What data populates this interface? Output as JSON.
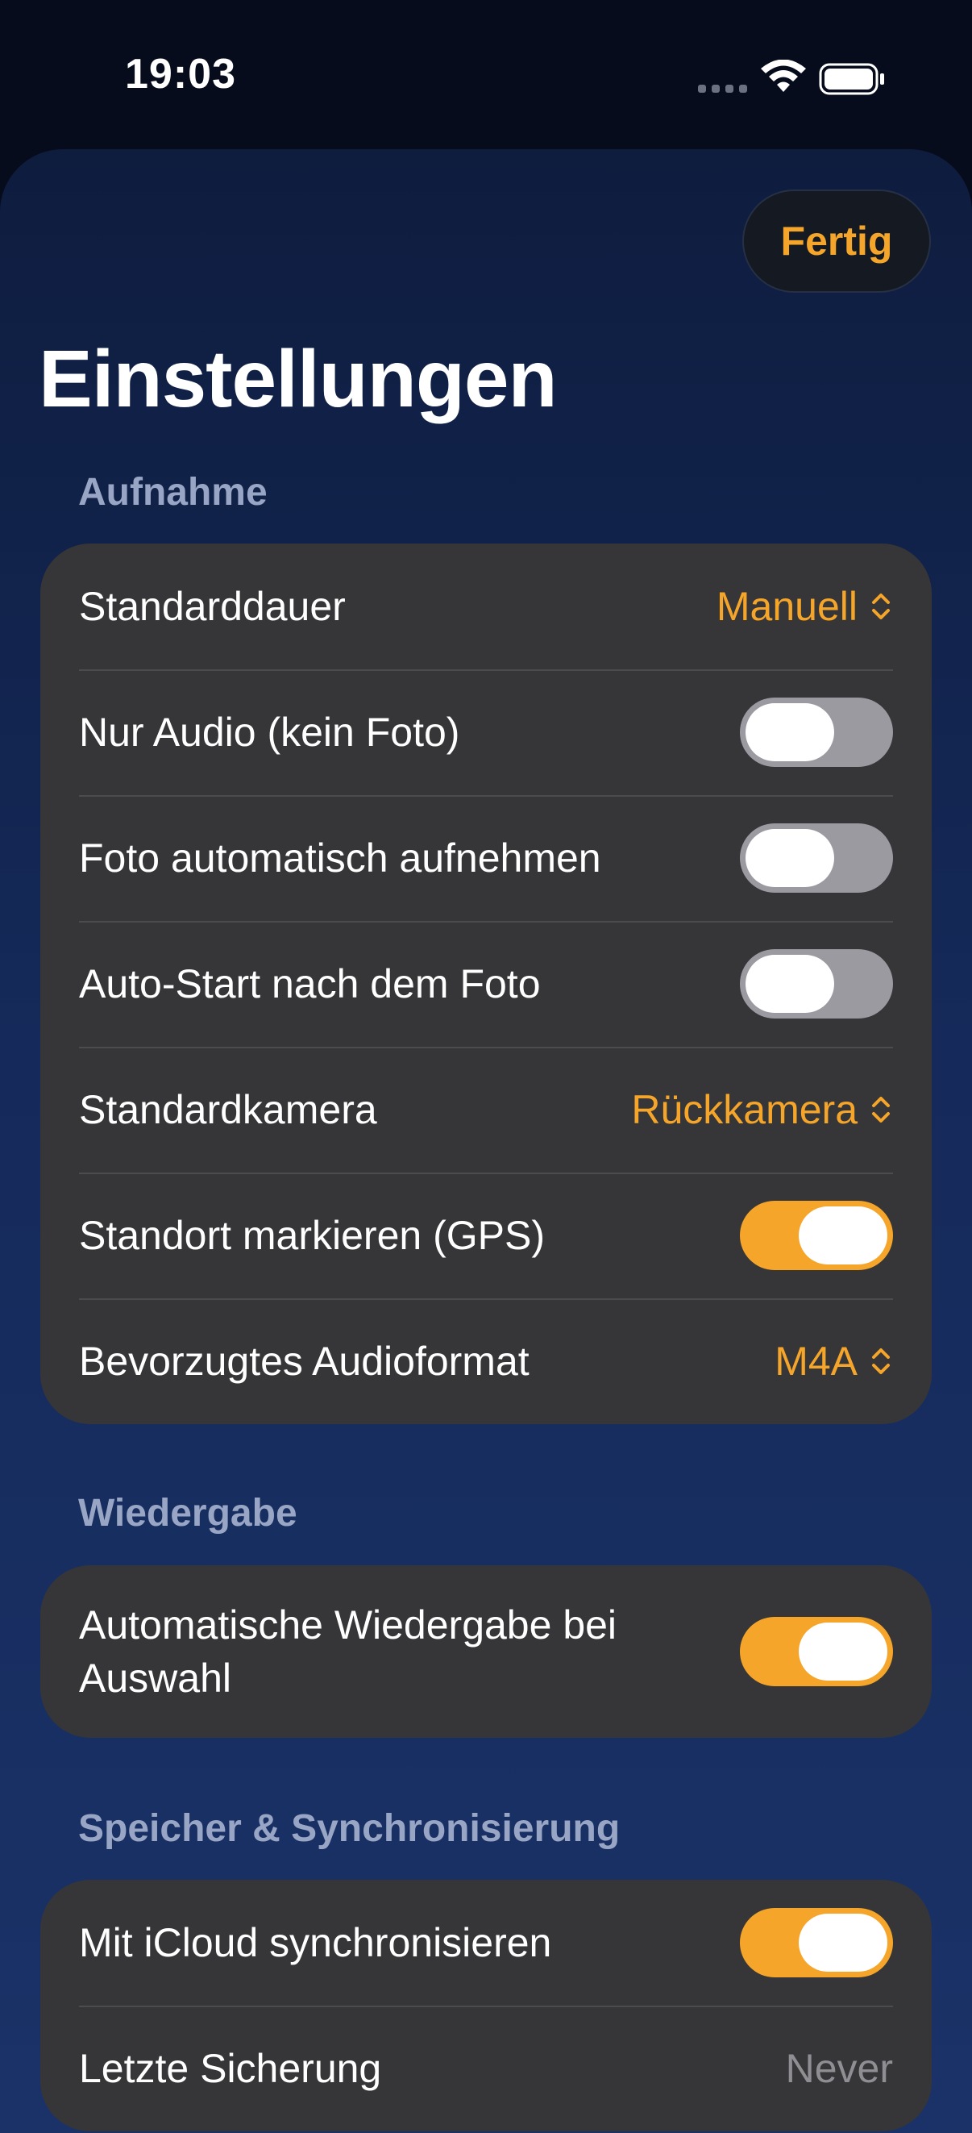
{
  "status_bar": {
    "time": "19:03"
  },
  "header": {
    "done_label": "Fertig",
    "title": "Einstellungen"
  },
  "colors": {
    "accent": "#f5a52a",
    "card": "#363638",
    "section_header": "#98a5c4",
    "toggle_off": "#9a9aa0"
  },
  "sections": [
    {
      "header": "Aufnahme",
      "rows": [
        {
          "label": "Standarddauer",
          "type": "picker",
          "value": "Manuell"
        },
        {
          "label": "Nur Audio (kein Foto)",
          "type": "toggle",
          "on": false
        },
        {
          "label": "Foto automatisch aufnehmen",
          "type": "toggle",
          "on": false
        },
        {
          "label": "Auto-Start nach dem Foto",
          "type": "toggle",
          "on": false
        },
        {
          "label": "Standardkamera",
          "type": "picker",
          "value": "Rückkamera"
        },
        {
          "label": "Standort markieren (GPS)",
          "type": "toggle",
          "on": true
        },
        {
          "label": "Bevorzugtes Audioformat",
          "type": "picker",
          "value": "M4A"
        }
      ]
    },
    {
      "header": "Wiedergabe",
      "rows": [
        {
          "label": "Automatische Wiedergabe bei Auswahl",
          "type": "toggle",
          "on": true
        }
      ]
    },
    {
      "header": "Speicher & Synchronisierung",
      "rows": [
        {
          "label": "Mit iCloud synchronisieren",
          "type": "toggle",
          "on": true
        },
        {
          "label": "Letzte Sicherung",
          "type": "text",
          "value": "Never"
        }
      ]
    }
  ]
}
